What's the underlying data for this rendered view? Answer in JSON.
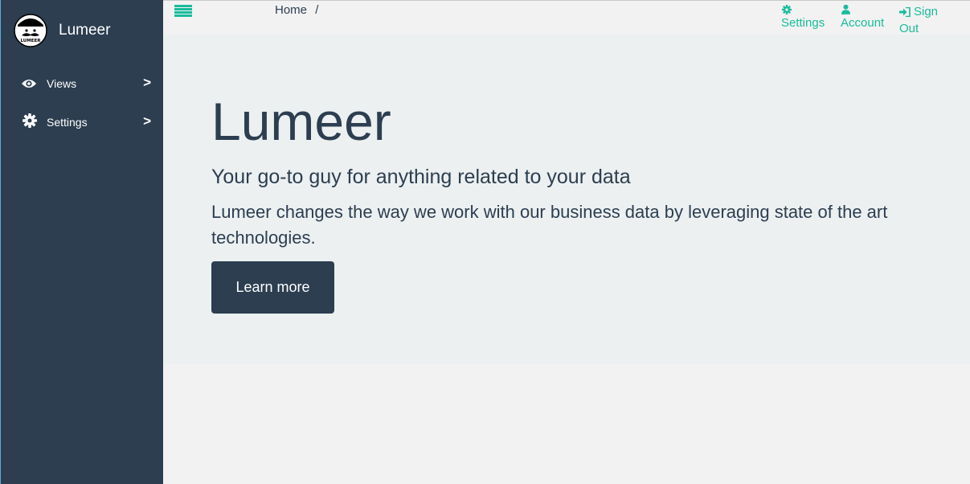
{
  "sidebar": {
    "brand_name": "Lumeer",
    "logo_text": "LUMEER",
    "items": [
      {
        "label": "Views",
        "icon": "eye-icon",
        "chevron": ">"
      },
      {
        "label": "Settings",
        "icon": "gear-icon",
        "chevron": ">"
      }
    ]
  },
  "topbar": {
    "breadcrumb": {
      "home": "Home",
      "separator": "/"
    },
    "links": [
      {
        "icon": "gear-icon",
        "label": "Settings"
      },
      {
        "icon": "user-icon",
        "label": "Account"
      },
      {
        "icon": "sign-out-icon",
        "label_line1": "Sign",
        "label_line2": "Out"
      }
    ]
  },
  "hero": {
    "title": "Lumeer",
    "lead": "Your go-to guy for anything related to your data",
    "text": "Lumeer changes the way we work with our business data by leveraging state of the art technologies.",
    "button_label": "Learn more"
  },
  "colors": {
    "sidebar_bg": "#2c3e50",
    "accent": "#18bc9c",
    "hero_bg": "#ecf0f1",
    "page_bg": "#f2f2f2"
  }
}
